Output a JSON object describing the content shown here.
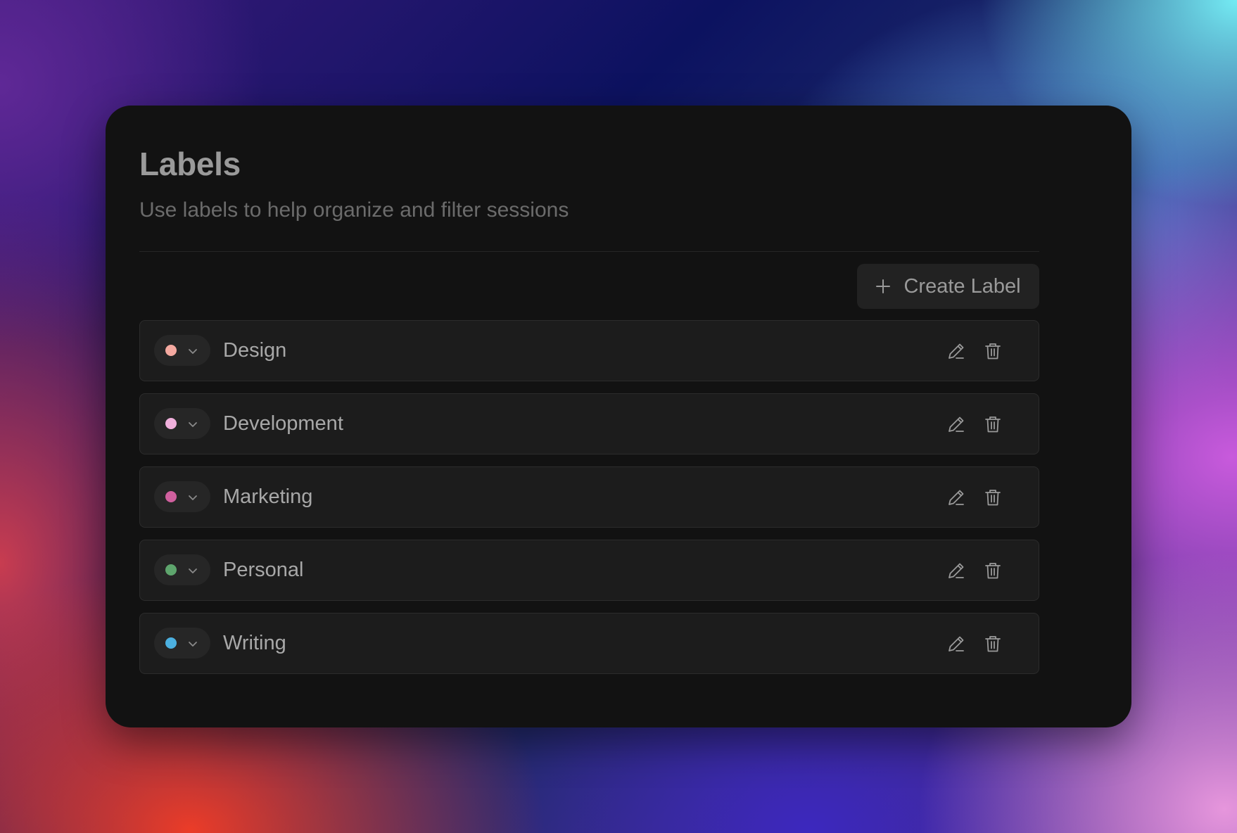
{
  "panel": {
    "title": "Labels",
    "subtitle": "Use labels to help organize and filter sessions"
  },
  "toolbar": {
    "create_label": "Create Label",
    "create_icon": "plus-icon"
  },
  "labels": [
    {
      "name": "Design",
      "color": "#f4a9a0"
    },
    {
      "name": "Development",
      "color": "#f0b0dc"
    },
    {
      "name": "Marketing",
      "color": "#d0609e"
    },
    {
      "name": "Personal",
      "color": "#5ea56d"
    },
    {
      "name": "Writing",
      "color": "#4cb0e0"
    }
  ],
  "row_icons": {
    "color_menu": "chevron-down-icon",
    "edit": "pencil-icon",
    "delete": "trash-icon"
  },
  "colors": {
    "card_background": "#121212",
    "row_background": "#1c1c1c",
    "button_background": "#222222"
  }
}
